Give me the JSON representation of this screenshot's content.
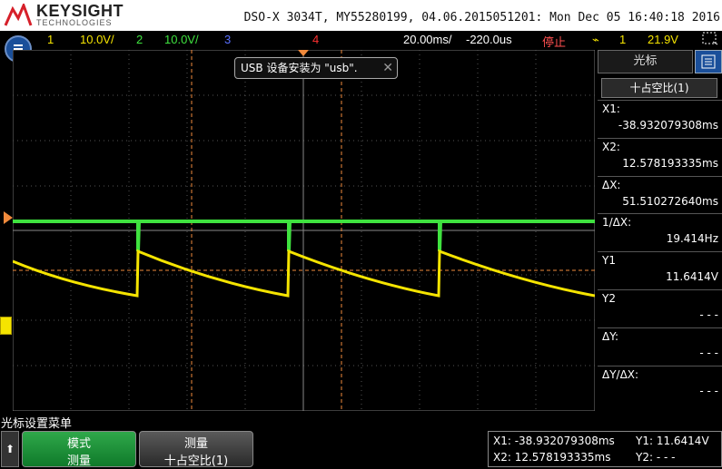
{
  "brand": {
    "name": "KEYSIGHT",
    "sub": "TECHNOLOGIES"
  },
  "header": {
    "info": "DSO-X 3034T, MY55280199, 04.06.2015051201: Mon Dec 05 16:40:18 2016"
  },
  "channels": {
    "ch1_num": "1",
    "ch1_scale": "10.0V/",
    "ch2_num": "2",
    "ch2_scale": "10.0V/",
    "ch3_num": "3",
    "ch4_num": "4",
    "timebase": "20.00ms/",
    "delay": "-220.0us",
    "run_state": "停止",
    "trig_source": "1",
    "trig_level": "21.9V"
  },
  "toast": {
    "text": "USB 设备安装为 \"usb\".",
    "close": "✕"
  },
  "side": {
    "tab_label": "光标",
    "selected_source": "十占空比(1)",
    "items": [
      {
        "label": "X1:",
        "value": "-38.932079308ms"
      },
      {
        "label": "X2:",
        "value": "12.578193335ms"
      },
      {
        "label": "ΔX:",
        "value": "51.510272640ms"
      },
      {
        "label": "1/ΔX:",
        "value": "19.414Hz"
      },
      {
        "label": "Y1",
        "value": "11.6414V"
      },
      {
        "label": "Y2",
        "value": "- - -"
      },
      {
        "label": "ΔY:",
        "value": "- - -"
      },
      {
        "label": "ΔY/ΔX:",
        "value": "- - -"
      }
    ]
  },
  "softkeys": {
    "menu_title": "光标设置菜单",
    "up": "⬆",
    "mode_top": "模式",
    "mode_bottom": "测量",
    "measure_top": "测量",
    "measure_bottom": "十占空比(1)"
  },
  "readout": {
    "x1": "X1: -38.932079308ms",
    "x2": "X2: 12.578193335ms",
    "y1": "Y1: 11.6414V",
    "y2": "Y2: - - -"
  },
  "colors": {
    "ch1": "#f5e400",
    "ch2": "#3fe23f",
    "ch3": "#5a70ff",
    "ch4": "#ff3030",
    "cursor": "#f08a3c",
    "brand_red": "#d6202a",
    "accent_blue": "#1a4f9a"
  },
  "icons": {
    "home": "home-icon",
    "menu": "menu-icon",
    "trigger": "trigger-edge-icon"
  }
}
